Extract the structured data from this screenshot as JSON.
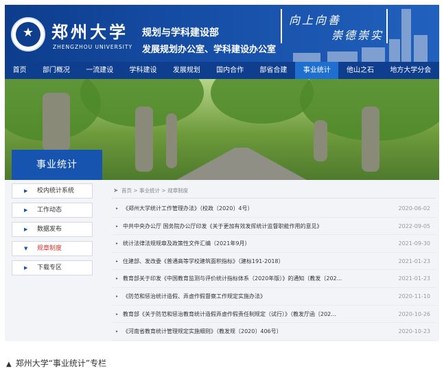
{
  "header": {
    "university_cn": "郑州大学",
    "university_en": "ZHENGZHOU UNIVERSITY",
    "dept_line1": "规划与学科建设部",
    "dept_line2": "发展规划办公室、学科建设办公室",
    "motto_line1": "向上向善",
    "motto_line2": "崇德崇实",
    "logo_icon": "university-seal-icon"
  },
  "nav": {
    "items": [
      {
        "label": "首页"
      },
      {
        "label": "部门概况"
      },
      {
        "label": "一流建设"
      },
      {
        "label": "学科建设"
      },
      {
        "label": "发展规划"
      },
      {
        "label": "国内合作"
      },
      {
        "label": "部省合建"
      },
      {
        "label": "事业统计",
        "active": true
      },
      {
        "label": "他山之石"
      },
      {
        "label": "地方大学分会"
      }
    ]
  },
  "banner": {
    "label": "事业统计"
  },
  "sidebar": {
    "items": [
      {
        "label": "校内统计系统"
      },
      {
        "label": "工作动态"
      },
      {
        "label": "数据发布"
      },
      {
        "label": "规章制度",
        "active": true
      },
      {
        "label": "下载专区"
      }
    ]
  },
  "breadcrumb": {
    "icon": "location-icon",
    "text": "首页 > 事业统计 > 规章制度"
  },
  "list": {
    "rows": [
      {
        "title": "《郑州大学统计工作管理办法》（校政〔2020〕4号）",
        "date": "2020-06-02"
      },
      {
        "title": "中共中央办公厅 国务院办公厅印发《关于更加有效发挥统计监督职能作用的意见》",
        "date": "2022-09-05"
      },
      {
        "title": "统计法律法规规章及政策性文件汇编（2021年9月）",
        "date": "2021-09-30"
      },
      {
        "title": "住建部、发改委《普通高等学校建筑面积指标》（建标191-2018）",
        "date": "2021-01-23"
      },
      {
        "title": "教育部关于印发《中国教育监测与评价统计指标体系（2020年版）》的通知（教发〔202...",
        "date": "2021-01-23"
      },
      {
        "title": "《防范和惩治统计造假、弄虚作假督察工作规定实施办法》",
        "date": "2020-11-10"
      },
      {
        "title": "教育部《关于防范和惩治教育统计造假弄虚作假责任制规定（试行）》（教发厅函〔202...",
        "date": "2020-10-26"
      },
      {
        "title": "《河南省教育统计管理规定实施细则》（教发规〔2020〕406号）",
        "date": "2020-10-23"
      }
    ]
  },
  "caption": {
    "marker": "▲",
    "text": "郑州大学“事业统计”专栏"
  },
  "colors": {
    "header_blue": "#164ea6",
    "nav_blue": "#0f3e8e",
    "active_blue": "#1e6fd0",
    "active_red": "#d4382c"
  }
}
